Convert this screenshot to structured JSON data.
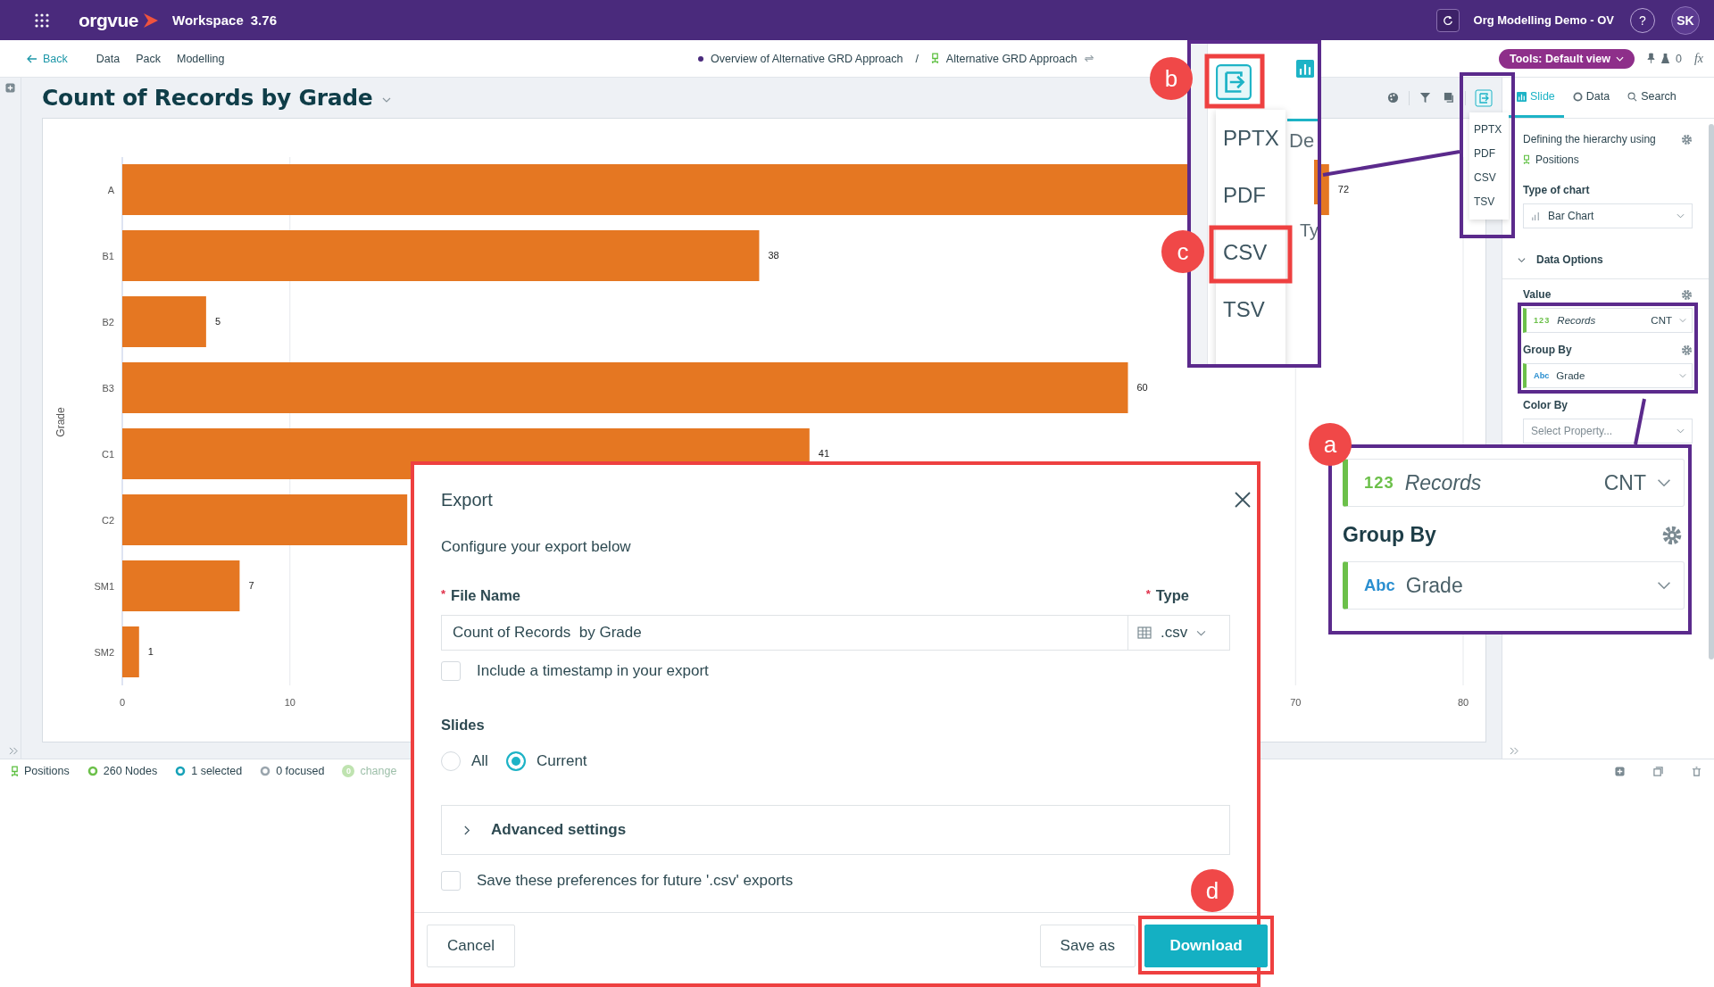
{
  "top_bar": {
    "brand": "orgvue",
    "workspace": "Workspace",
    "version": "3.76",
    "org": "Org Modelling Demo - OV",
    "help": "?",
    "avatar": "SK"
  },
  "nav_bar": {
    "back": "Back",
    "menu": [
      {
        "label": "Data"
      },
      {
        "label": "Pack"
      },
      {
        "label": "Modelling"
      }
    ],
    "breadcrumb": {
      "parent": "Overview of Alternative GRD Approach",
      "separator": "/",
      "current": "Alternative GRD Approach"
    },
    "tools": "Tools: Default view",
    "count": "0",
    "formula": "fx"
  },
  "slide": {
    "title": "Count of Records by Grade",
    "chart_data": {
      "type": "bar",
      "orientation": "horizontal",
      "ylabel": "Grade",
      "categories": [
        "A",
        "B1",
        "B2",
        "B3",
        "C1",
        "C2",
        "SM1",
        "SM2"
      ],
      "values": [
        72,
        38,
        5,
        60,
        41,
        17,
        7,
        1
      ],
      "value_labels": [
        "72",
        "38",
        "5",
        "60",
        "41",
        null,
        "7",
        "1"
      ],
      "xlim": [
        0,
        80
      ],
      "xticks": [
        0,
        10,
        70,
        80
      ],
      "grid": true
    }
  },
  "right_panel": {
    "export_menu": {
      "highlighted": true,
      "items": [
        "PPTX",
        "PDF",
        "CSV",
        "TSV"
      ]
    },
    "tabs": [
      {
        "label": "Slide",
        "selected": true
      },
      {
        "label": "Data",
        "selected": false
      },
      {
        "label": "Search",
        "selected": false
      }
    ],
    "hierarchy_label": "Defining the hierarchy using",
    "hierarchy_value": "Positions",
    "chart_type_label": "Type of chart",
    "chart_type": "Bar Chart",
    "section": "Data Options",
    "section_expanded": true,
    "fields_highlighted": true,
    "value_label": "Value",
    "value_field": {
      "tag": "123",
      "name": "Records",
      "aggregate": "CNT"
    },
    "group_by_label": "Group By",
    "group_by_field": {
      "tag": "Abc",
      "name": "Grade"
    },
    "color_by_label": "Color By",
    "color_by_placeholder": "Select Property..."
  },
  "status_bar": [
    {
      "kind": "positions",
      "label": "Positions"
    },
    {
      "kind": "nodes",
      "label": "260 Nodes"
    },
    {
      "kind": "selected",
      "label": "1 selected"
    },
    {
      "kind": "focused",
      "label": "0 focused"
    },
    {
      "kind": "changes",
      "count": "0",
      "label": "change"
    }
  ],
  "export_dialog": {
    "highlighted": true,
    "title": "Export",
    "subtitle": "Configure your export below",
    "file_name_label": "File Name",
    "type_label": "Type",
    "required_mark": "*",
    "file_name": "Count of Records  by Grade",
    "type": ".csv",
    "timestamp": {
      "label": "Include a timestamp in your export",
      "checked": false
    },
    "slides_label": "Slides",
    "slides": [
      {
        "label": "All",
        "selected": false
      },
      {
        "label": "Current",
        "selected": true
      }
    ],
    "advanced": {
      "label": "Advanced settings",
      "expanded": false
    },
    "save_prefs": {
      "label": "Save these preferences for future '.csv' exports",
      "checked": false
    },
    "cancel": "Cancel",
    "save_as": "Save as",
    "download": {
      "label": "Download",
      "highlighted": true
    }
  },
  "callout_b": {
    "badge": "b",
    "icon_highlighted": true,
    "fragments": [
      "De",
      "Ty"
    ],
    "items": [
      {
        "label": "PPTX",
        "highlighted": false
      },
      {
        "label": "PDF",
        "highlighted": false
      },
      {
        "label": "CSV",
        "highlighted": true
      },
      {
        "label": "TSV",
        "highlighted": false
      }
    ]
  },
  "badge_c": "c",
  "badge_d": "d",
  "callout_a": {
    "badge": "a",
    "value_field": {
      "tag": "123",
      "name": "Records",
      "aggregate": "CNT"
    },
    "group_by_label": "Group By",
    "group_by_field": {
      "tag": "Abc",
      "name": "Grade"
    }
  }
}
